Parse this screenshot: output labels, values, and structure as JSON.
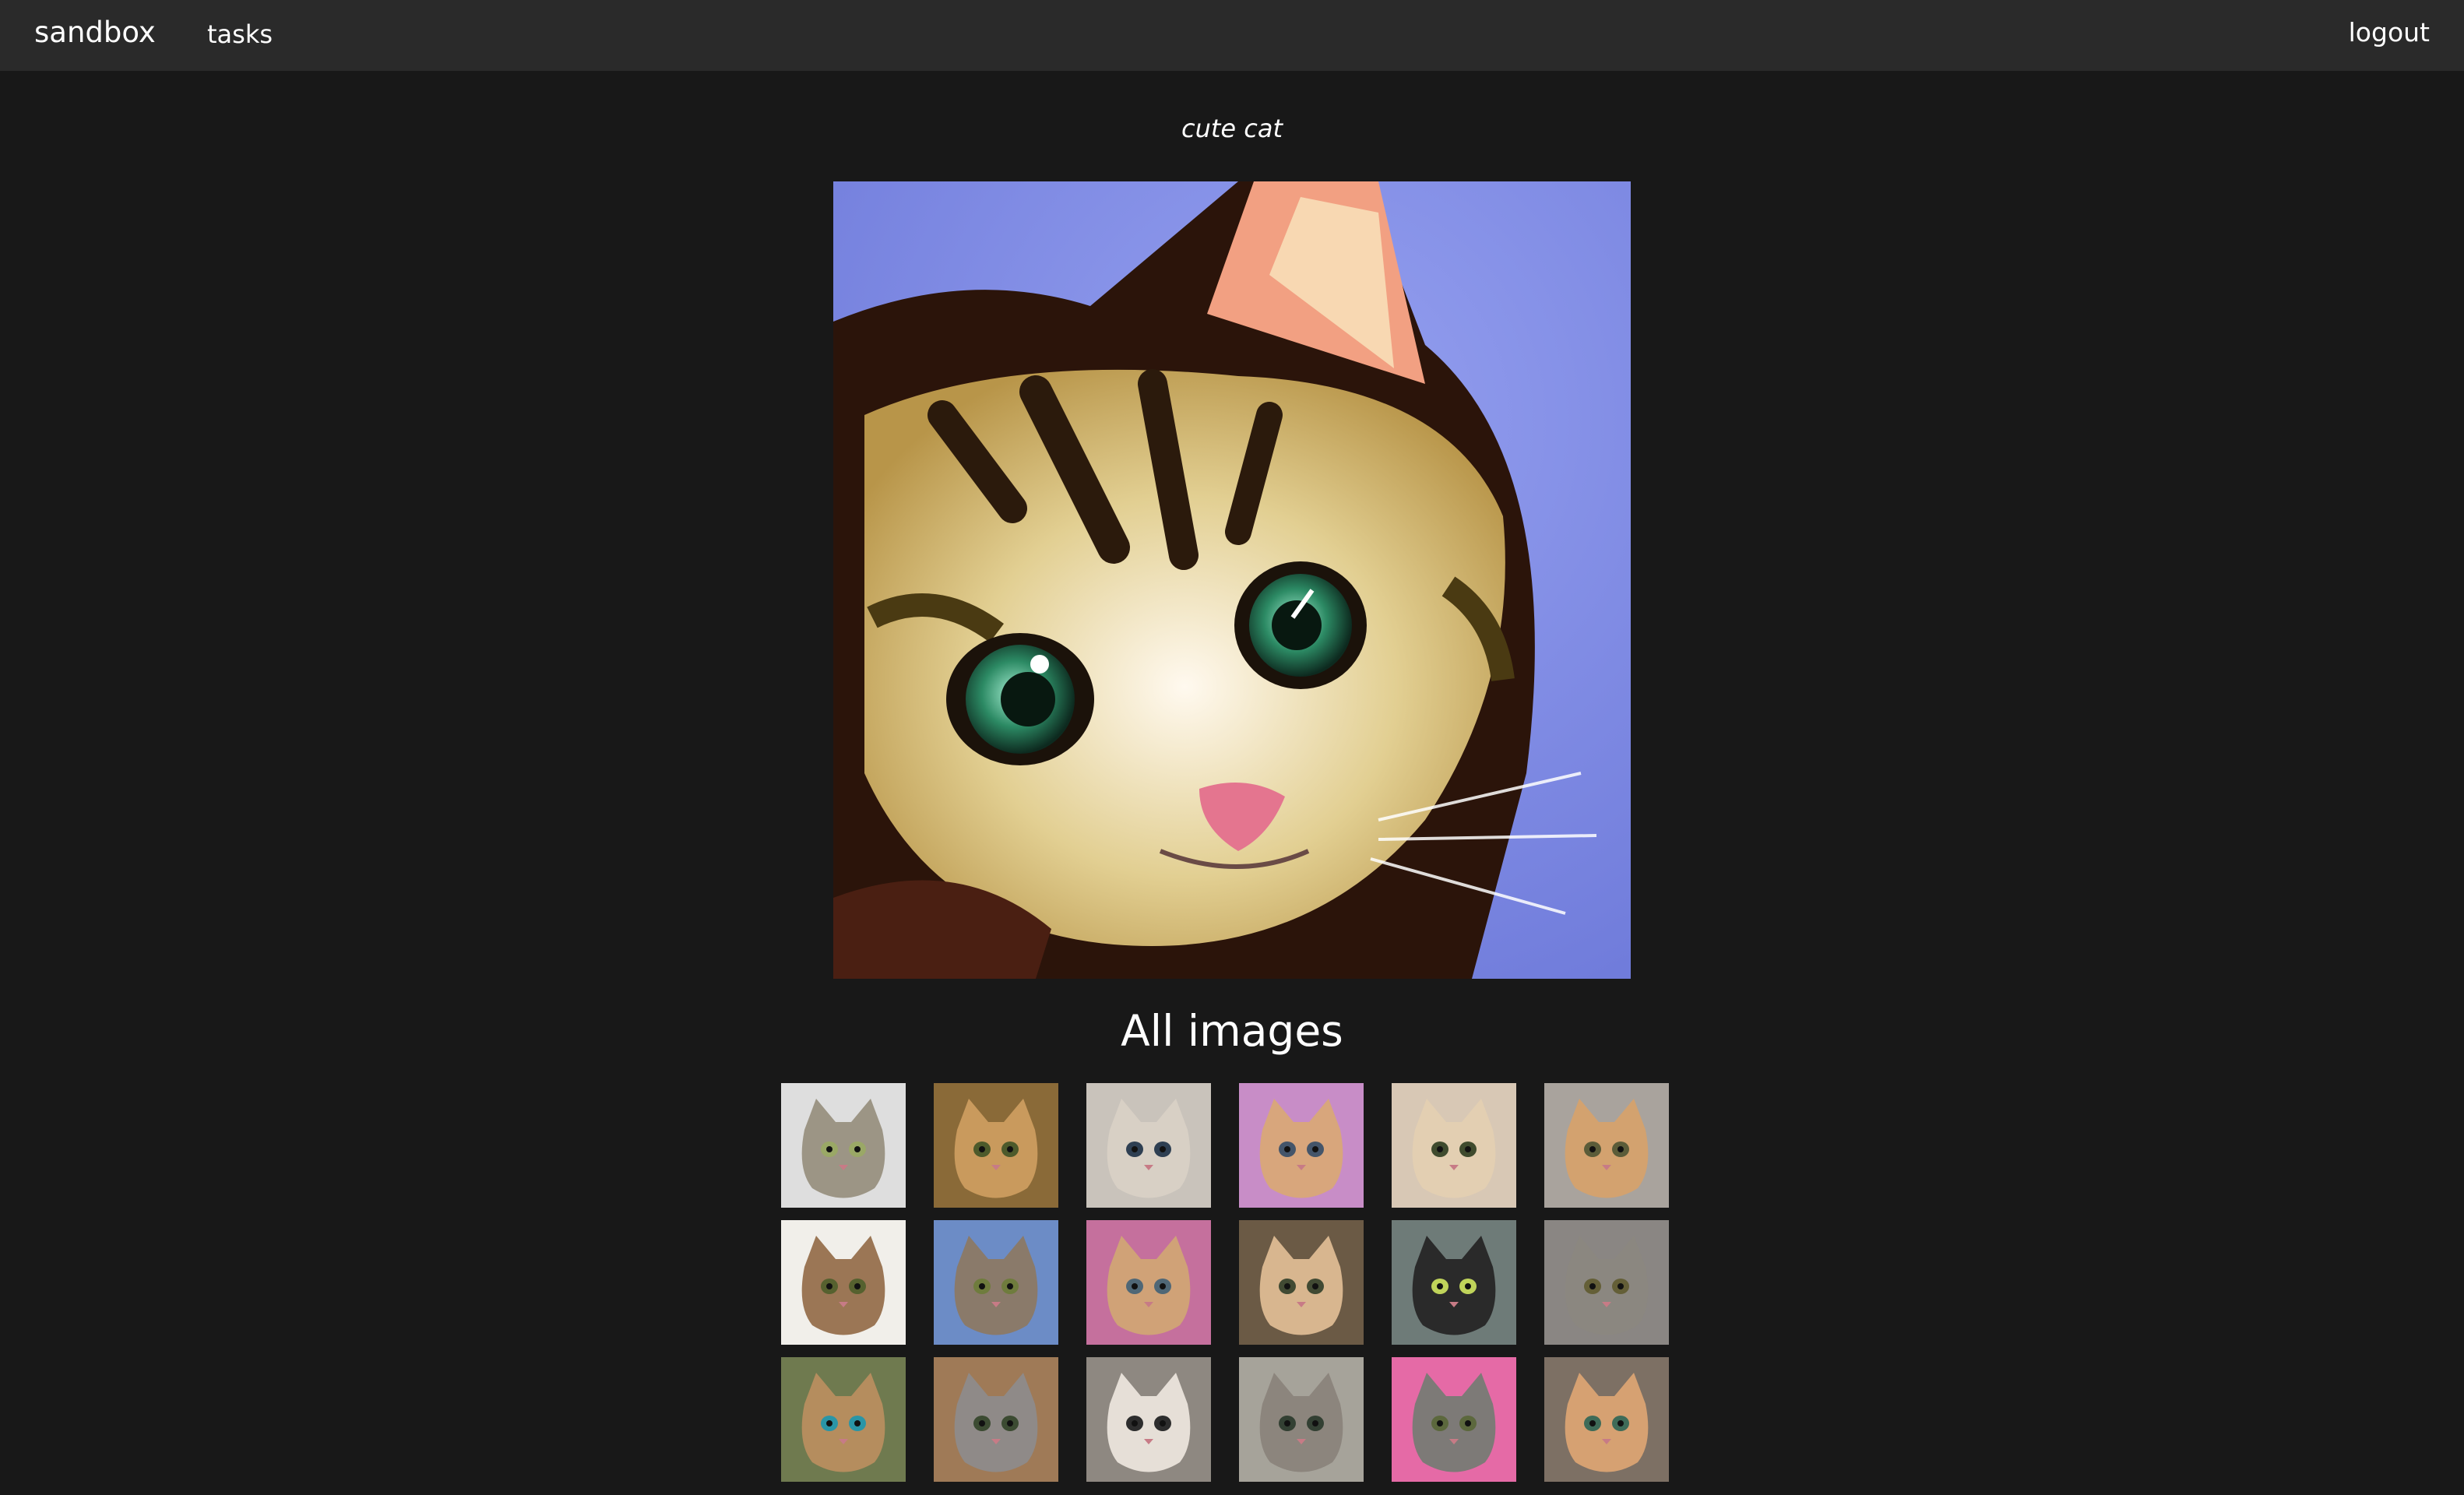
{
  "nav": {
    "brand": "sandbox",
    "tasks": "tasks",
    "logout": "logout"
  },
  "prompt": "cute cat",
  "gallery_title": "All images",
  "colors": {
    "page_bg": "#181818",
    "navbar_bg": "#2a2a2a",
    "text": "#ffffff"
  },
  "thumbnails": [
    {
      "bg": "#dedede",
      "fur": "#9c9585",
      "eye": "#9aa866"
    },
    {
      "bg": "#8a6a38",
      "fur": "#c99a5d",
      "eye": "#4d5a2b"
    },
    {
      "bg": "#c9c3bb",
      "fur": "#d8d0c5",
      "eye": "#2e3f52"
    },
    {
      "bg": "#c88dc7",
      "fur": "#d8a67c",
      "eye": "#44556a"
    },
    {
      "bg": "#d8c8b5",
      "fur": "#e3cfb2",
      "eye": "#3f4b2e"
    },
    {
      "bg": "#a9a39d",
      "fur": "#d3a26f",
      "eye": "#5b5c39"
    },
    {
      "bg": "#f1efea",
      "fur": "#9b7655",
      "eye": "#56612f"
    },
    {
      "bg": "#6c8cc6",
      "fur": "#8a7a6a",
      "eye": "#6f7c3d"
    },
    {
      "bg": "#c5709d",
      "fur": "#d0a277",
      "eye": "#4f6776"
    },
    {
      "bg": "#6b5a45",
      "fur": "#d8b68f",
      "eye": "#414a33"
    },
    {
      "bg": "#6e7b78",
      "fur": "#2a2a2a",
      "eye": "#bfd35a"
    },
    {
      "bg": "#8a8683",
      "fur": "#8b8780",
      "eye": "#645f37"
    },
    {
      "bg": "#6f7a4f",
      "fur": "#b58d5e",
      "eye": "#2a95a6"
    },
    {
      "bg": "#9f7a57",
      "fur": "#8f8a88",
      "eye": "#3c4b32"
    },
    {
      "bg": "#8e8881",
      "fur": "#e6dfd7",
      "eye": "#2d2d2d"
    },
    {
      "bg": "#a6a39a",
      "fur": "#8c857d",
      "eye": "#334033"
    },
    {
      "bg": "#e56aa6",
      "fur": "#7d7a77",
      "eye": "#5c683d"
    },
    {
      "bg": "#7d7064",
      "fur": "#d6a172",
      "eye": "#3e6b58"
    }
  ]
}
